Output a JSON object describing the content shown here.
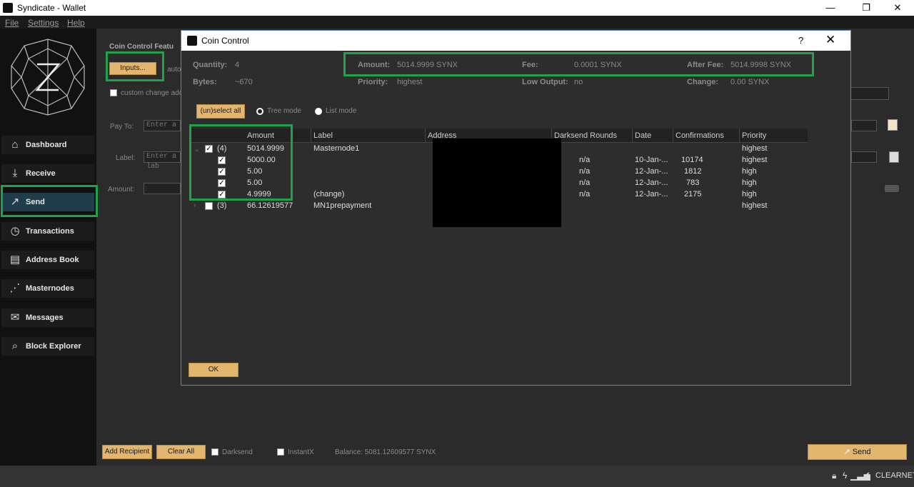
{
  "window": {
    "title": "Syndicate - Wallet",
    "minimize": "—",
    "restore": "❐",
    "close": "✕"
  },
  "menu": [
    "File",
    "Settings",
    "Help"
  ],
  "sidebar": {
    "items": [
      {
        "label": "Dashboard",
        "icon": "home-icon"
      },
      {
        "label": "Receive",
        "icon": "receive-arrow-icon"
      },
      {
        "label": "Send",
        "icon": "send-arrow-icon"
      },
      {
        "label": "Transactions",
        "icon": "clock-icon"
      },
      {
        "label": "Address Book",
        "icon": "address-book-icon"
      },
      {
        "label": "Masternodes",
        "icon": "network-icon"
      },
      {
        "label": "Messages",
        "icon": "envelope-icon"
      },
      {
        "label": "Block Explorer",
        "icon": "magnifier-icon"
      }
    ]
  },
  "send": {
    "coin_control_title": "Coin Control Featu",
    "inputs_button": "Inputs...",
    "auto_text": "auto",
    "custom_change": "custom change add",
    "pay_to_label": "Pay To:",
    "pay_to_placeholder": "Enter a",
    "label_label": "Label:",
    "label_placeholder": "Enter a lab",
    "amount_label": "Amount:",
    "add_recipient": "Add Recipient",
    "clear_all": "Clear All",
    "darksend": "Darksend",
    "instantx": "InstantX",
    "balance": "Balance: 5081.12609577 SYNX",
    "send_button": "Send"
  },
  "status": {
    "network": "CLEARNET"
  },
  "dialog": {
    "title": "Coin Control",
    "help": "?",
    "close": "✕",
    "stats": {
      "quantity_label": "Quantity:",
      "quantity": "4",
      "bytes_label": "Bytes:",
      "bytes": "~670",
      "amount_label": "Amount:",
      "amount": "5014.9999 SYNX",
      "priority_label": "Priority:",
      "priority": "highest",
      "fee_label": "Fee:",
      "fee": "0.0001 SYNX",
      "low_output_label": "Low Output:",
      "low_output": "no",
      "after_fee_label": "After Fee:",
      "after_fee": "5014.9998 SYNX",
      "change_label": "Change:",
      "change": "0.00 SYNX"
    },
    "select_all": "(un)select all",
    "tree_mode": "Tree mode",
    "list_mode": "List mode",
    "columns": [
      "Amount",
      "Label",
      "Address",
      "Darksend Rounds",
      "Date",
      "Confirmations",
      "Priority"
    ],
    "rows": [
      {
        "group": "(4)",
        "amount": "5014.9999",
        "label": "Masternode1",
        "rounds": "",
        "date": "",
        "conf": "",
        "priority": "highest",
        "checked": true
      },
      {
        "group": "",
        "amount": "5000.00",
        "label": "",
        "rounds": "n/a",
        "date": "10-Jan-...",
        "conf": "10174",
        "priority": "highest",
        "checked": true
      },
      {
        "group": "",
        "amount": "5.00",
        "label": "",
        "rounds": "n/a",
        "date": "12-Jan-...",
        "conf": "1812",
        "priority": "high",
        "checked": true
      },
      {
        "group": "",
        "amount": "5.00",
        "label": "",
        "rounds": "n/a",
        "date": "12-Jan-...",
        "conf": "783",
        "priority": "high",
        "checked": true
      },
      {
        "group": "",
        "amount": "4.9999",
        "label": "(change)",
        "rounds": "n/a",
        "date": "12-Jan-...",
        "conf": "2175",
        "priority": "high",
        "checked": true
      },
      {
        "group": "(3)",
        "amount": "66.12619577",
        "label": "MN1prepayment",
        "rounds": "",
        "date": "",
        "conf": "",
        "priority": "highest",
        "checked": false
      }
    ],
    "ok_button": "OK"
  },
  "colors": {
    "highlight": "#1fa34a",
    "gold": "#e2b66f",
    "active_nav": "#1f3d4d"
  }
}
